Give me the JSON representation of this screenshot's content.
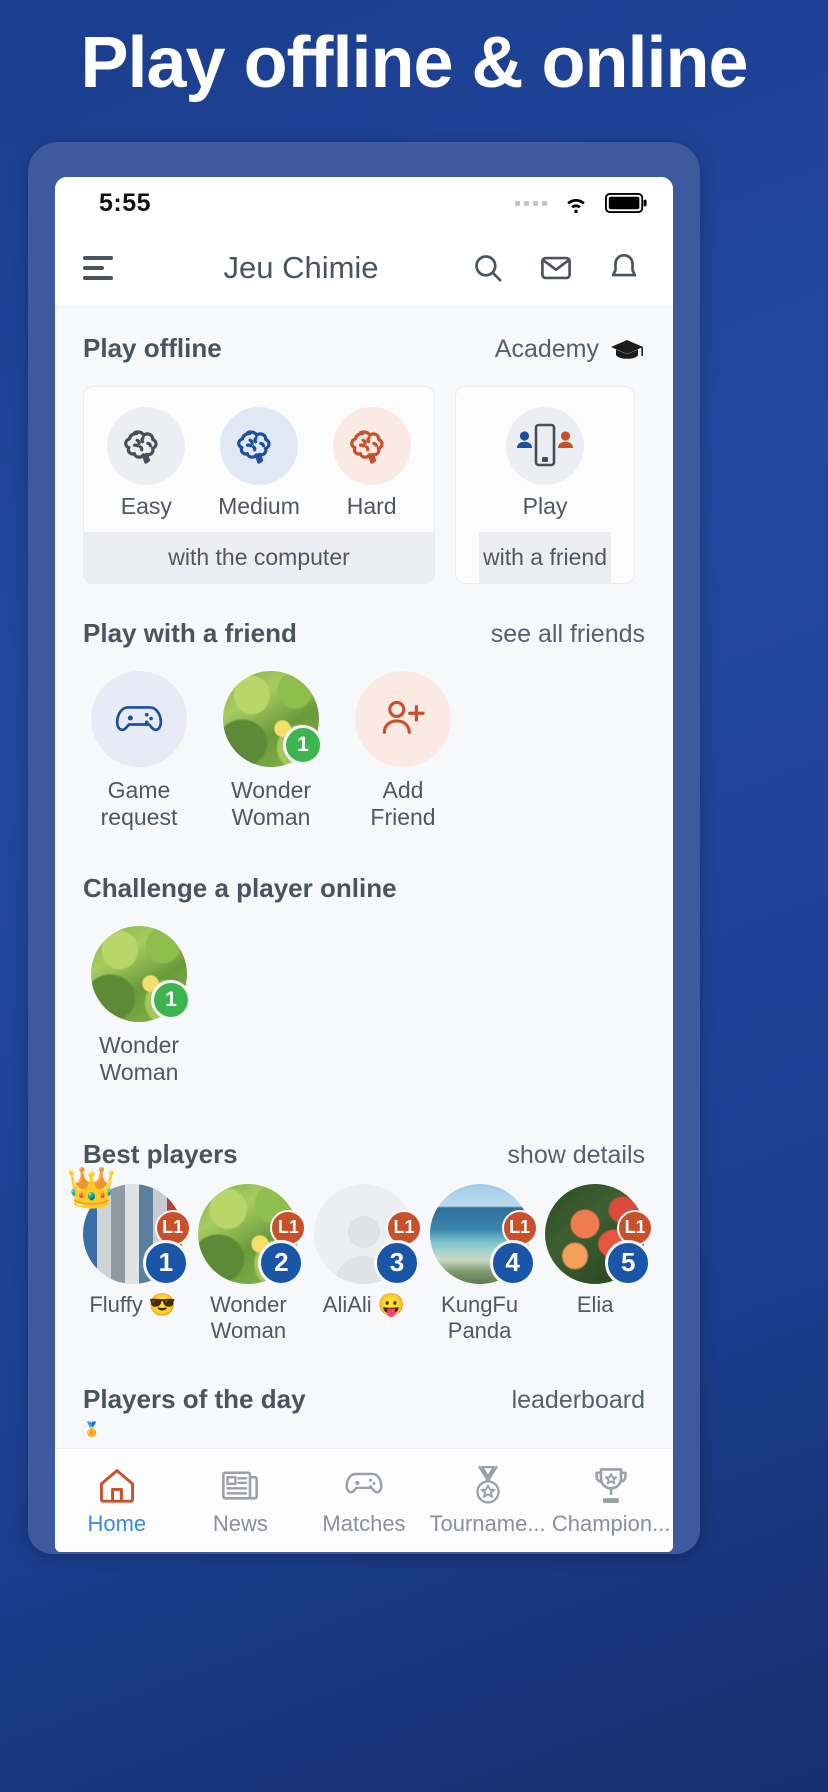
{
  "banner": {
    "title": "Play offline & online"
  },
  "status_bar": {
    "time": "5:55",
    "wifi_icon": "wifi-icon",
    "battery_icon": "battery-icon",
    "signal_icon": "signal-dots-icon"
  },
  "app_bar": {
    "menu_icon": "hamburger-menu-icon",
    "title": "Jeu Chimie",
    "search_icon": "search-icon",
    "mail_icon": "mail-icon",
    "bell_icon": "bell-icon"
  },
  "play_offline": {
    "title": "Play offline",
    "action": "Academy",
    "action_icon": "graduation-cap-icon",
    "computer_card": {
      "footer": "with the computer",
      "modes": [
        {
          "label": "Easy",
          "icon": "brain-icon",
          "color": "#46505c",
          "bubble": "#eceef1"
        },
        {
          "label": "Medium",
          "icon": "brain-icon",
          "color": "#1d4f9e",
          "bubble": "#e1e8f5"
        },
        {
          "label": "Hard",
          "icon": "brain-icon",
          "color": "#c8502a",
          "bubble": "#fbeae3"
        }
      ]
    },
    "friend_card": {
      "label": "Play",
      "footer": "with a friend",
      "icon": "two-players-phone-icon"
    }
  },
  "play_with_friend": {
    "title": "Play with a friend",
    "action": "see all friends",
    "items": [
      {
        "label": "Game\nrequest",
        "label_line1": "Game",
        "label_line2": "request",
        "icon": "gamepad-icon",
        "type": "icon",
        "badge": null
      },
      {
        "label": "Wonder Woman",
        "label_line1": "Wonder",
        "label_line2": "Woman",
        "icon": "",
        "type": "photo-leaf",
        "badge": "1"
      },
      {
        "label": "Add Friend",
        "label_line1": "Add",
        "label_line2": "Friend",
        "icon": "add-person-icon",
        "type": "icon",
        "badge": null
      }
    ]
  },
  "challenge_online": {
    "title": "Challenge a player online",
    "items": [
      {
        "label_line1": "Wonder",
        "label_line2": "Woman",
        "type": "photo-leaf",
        "badge": "1"
      }
    ]
  },
  "best_players": {
    "title": "Best players",
    "action": "show details",
    "items": [
      {
        "name": "Fluffy",
        "emoji": "😎",
        "rank": "1",
        "level": "L1",
        "crown": true,
        "type": "photo-collage"
      },
      {
        "name_line1": "Wonder",
        "name_line2": "Woman",
        "name": "Wonder Woman",
        "emoji": "",
        "rank": "2",
        "level": "L1",
        "crown": false,
        "type": "photo-leaf"
      },
      {
        "name": "AliAli",
        "emoji": "😛",
        "rank": "3",
        "level": "L1",
        "crown": false,
        "type": "photo-silhouette"
      },
      {
        "name_line1": "KungFu",
        "name_line2": "Panda",
        "name": "KungFu Panda",
        "emoji": "",
        "rank": "4",
        "level": "L1",
        "crown": false,
        "type": "photo-sea"
      },
      {
        "name": "Elia",
        "emoji": "",
        "rank": "5",
        "level": "L1",
        "crown": false,
        "type": "photo-flower"
      }
    ]
  },
  "players_of_the_day": {
    "title": "Players of the day",
    "action": "leaderboard"
  },
  "bottom_nav": {
    "items": [
      {
        "label": "Home",
        "icon": "home-icon",
        "active": true
      },
      {
        "label": "News",
        "icon": "news-icon",
        "active": false
      },
      {
        "label": "Matches",
        "icon": "gamepad-icon",
        "active": false
      },
      {
        "label": "Tourname...",
        "icon": "medal-icon",
        "active": false
      },
      {
        "label": "Champion...",
        "icon": "trophy-icon",
        "active": false
      }
    ]
  },
  "colors": {
    "brand_blue": "#1d4f9e",
    "accent_orange": "#c8502a",
    "active_nav": "#3a8ae0",
    "badge_green": "#3cb551",
    "rank_blue": "#1a56a8",
    "banner_bg": "#1d3f92"
  }
}
